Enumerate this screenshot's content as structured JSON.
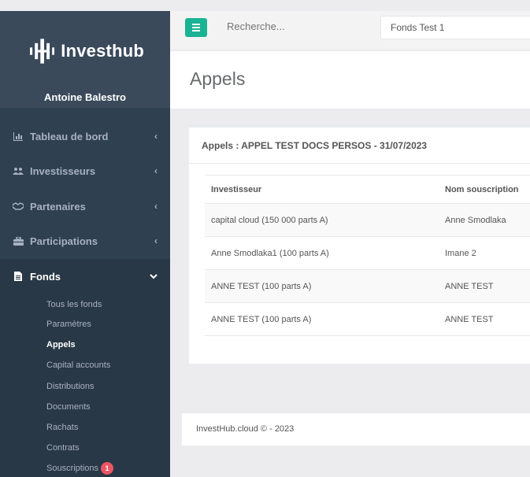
{
  "brand": {
    "name": "Investhub",
    "user": "Antoine Balestro"
  },
  "nav": [
    {
      "label": "Tableau de bord",
      "icon": "chart-icon"
    },
    {
      "label": "Investisseurs",
      "icon": "users-icon"
    },
    {
      "label": "Partenaires",
      "icon": "handshake-icon"
    },
    {
      "label": "Participations",
      "icon": "briefcase-icon"
    },
    {
      "label": "Fonds",
      "icon": "file-icon"
    }
  ],
  "submenu": {
    "items": [
      "Tous les fonds",
      "Paramètres",
      "Appels",
      "Capital accounts",
      "Distributions",
      "Documents",
      "Rachats",
      "Contrats",
      "Souscriptions"
    ],
    "badge": "1"
  },
  "topbar": {
    "search_placeholder": "Recherche...",
    "fund": "Fonds Test 1"
  },
  "page": {
    "title": "Appels"
  },
  "panel": {
    "title": "Appels : APPEL TEST DOCS PERSOS - 31/07/2023",
    "headers": [
      "Investisseur",
      "Nom souscription"
    ],
    "rows": [
      [
        "capital cloud (150 000 parts A)",
        "Anne Smodlaka"
      ],
      [
        "Anne Smodlaka1 (100 parts A)",
        "Imane 2"
      ],
      [
        "ANNE TEST (100 parts A)",
        "ANNE TEST"
      ],
      [
        "ANNE TEST (100 parts A)",
        "ANNE TEST"
      ]
    ]
  },
  "footer": {
    "text": "InvestHub.cloud © - 2023"
  },
  "colors": {
    "sidebar": "#2f4050",
    "accent": "#1ab394",
    "badge": "#ed5565"
  }
}
